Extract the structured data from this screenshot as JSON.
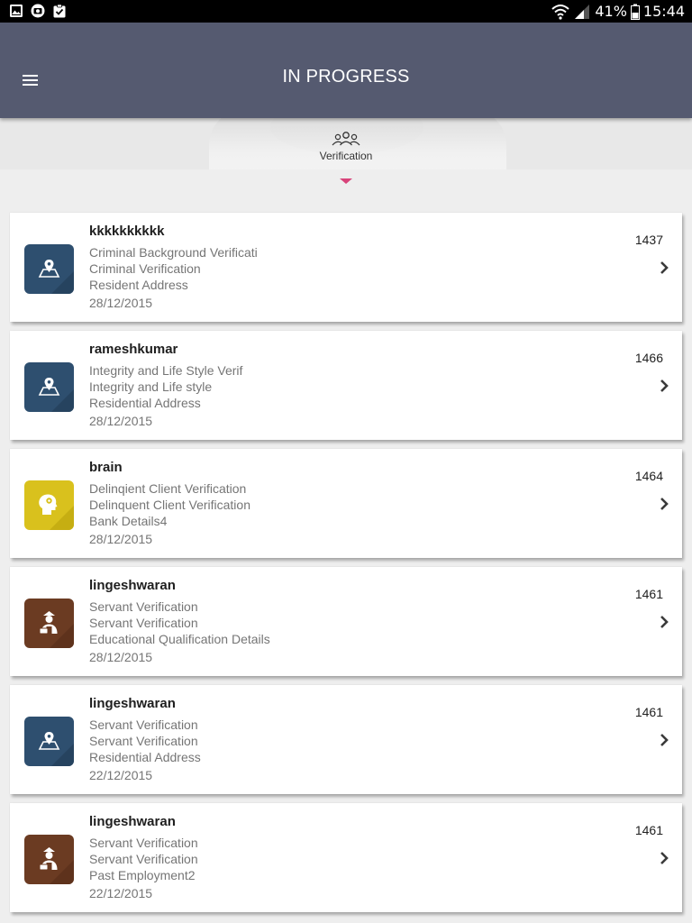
{
  "status_bar": {
    "battery": "41%",
    "time": "15:44",
    "left_icons": [
      "gallery-icon",
      "camera-icon",
      "clipboard-check-icon"
    ],
    "right_icons": [
      "wifi-icon",
      "signal-icon",
      "battery-icon"
    ]
  },
  "app_bar": {
    "title": "IN PROGRESS",
    "menu_icon": "hamburger-menu-icon"
  },
  "tabs": [
    {
      "label": "Verification",
      "icon": "people-group-icon",
      "active": true
    }
  ],
  "colors": {
    "app_bar": "#555a70",
    "indicator": "#d8437a",
    "icon_blue": "#2e4f6f",
    "icon_yellow": "#d9c11d",
    "icon_brown": "#6b3b22"
  },
  "cases": [
    {
      "name": "kkkkkkkkkk",
      "line1": "Criminal Background Verificati",
      "line2": "Criminal Verification",
      "line3": "Resident Address",
      "date": "28/12/2015",
      "id": "1437",
      "icon": "map-location-icon"
    },
    {
      "name": "rameshkumar",
      "line1": "Integrity and Life Style Verif",
      "line2": "Integrity and Life style",
      "line3": "Residential Address",
      "date": "28/12/2015",
      "id": "1466",
      "icon": "map-location-icon"
    },
    {
      "name": "brain",
      "line1": "Delinqient Client Verification",
      "line2": "Delinquent Client Verification",
      "line3": "Bank Details4",
      "date": "28/12/2015",
      "id": "1464",
      "icon": "head-gear-icon"
    },
    {
      "name": "lingeshwaran",
      "line1": "Servant Verification",
      "line2": "Servant Verification",
      "line3": "Educational Qualification Details",
      "date": "28/12/2015",
      "id": "1461",
      "icon": "servant-icon"
    },
    {
      "name": "lingeshwaran",
      "line1": "Servant Verification",
      "line2": "Servant Verification",
      "line3": "Residential Address",
      "date": "22/12/2015",
      "id": "1461",
      "icon": "map-location-icon"
    },
    {
      "name": "lingeshwaran",
      "line1": "Servant Verification",
      "line2": "Servant Verification",
      "line3": "Past Employment2",
      "date": "22/12/2015",
      "id": "1461",
      "icon": "servant-icon"
    }
  ]
}
